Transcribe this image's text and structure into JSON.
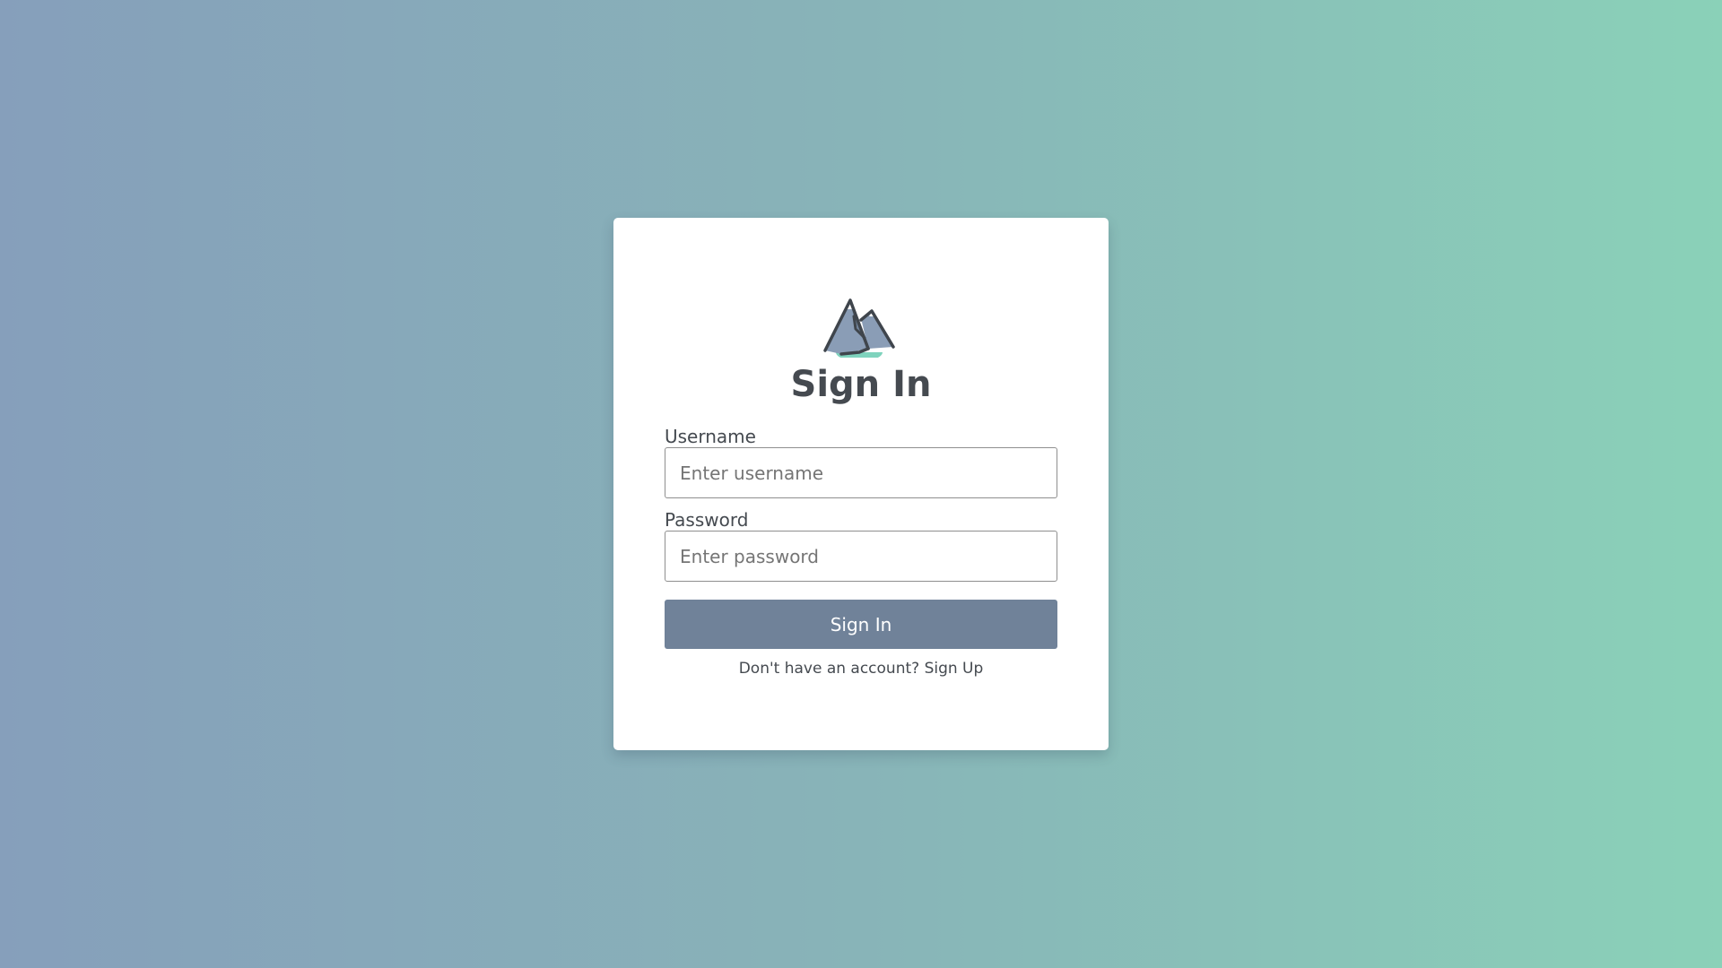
{
  "form": {
    "title": "Sign In",
    "username_label": "Username",
    "username_placeholder": "Enter username",
    "username_value": "",
    "password_label": "Password",
    "password_placeholder": "Enter password",
    "password_value": "",
    "submit_label": "Sign In",
    "signup_prompt": "Don't have an account?",
    "signup_link": "Sign Up"
  },
  "icons": {
    "logo": "mountain-logo-icon"
  },
  "colors": {
    "background_start": "#869fbb",
    "background_end": "#8ad1b8",
    "button": "#708299",
    "text": "#454a50",
    "logo_accent": "#7fd3bd"
  }
}
